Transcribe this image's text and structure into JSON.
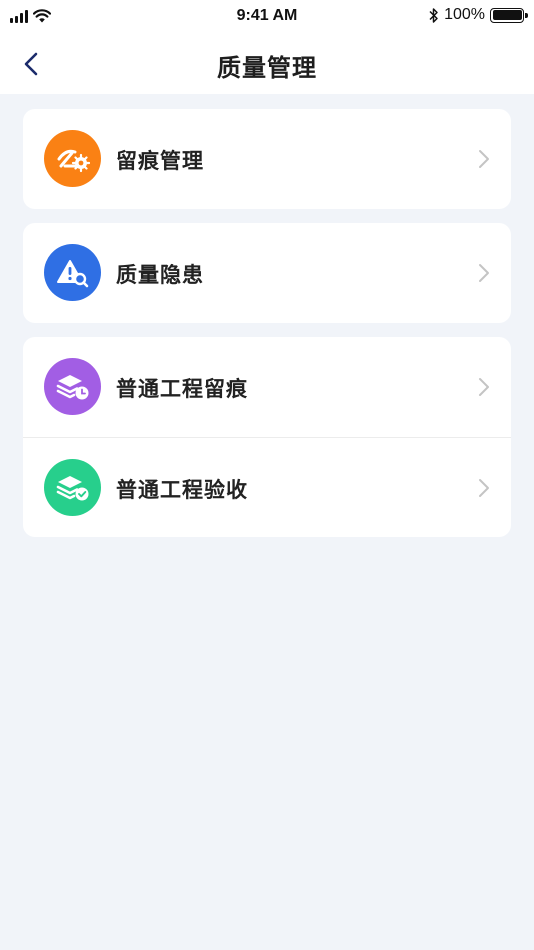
{
  "status_bar": {
    "time": "9:41 AM",
    "battery": "100%",
    "icons": [
      "signal-icon",
      "wifi-icon",
      "bluetooth-icon",
      "battery-icon"
    ]
  },
  "nav": {
    "title": "质量管理",
    "back_icon": "chevron-left-icon"
  },
  "menu": {
    "cards": [
      {
        "items": [
          {
            "label": "留痕管理",
            "icon": "trace-settings-icon",
            "color": "#fa8114"
          }
        ]
      },
      {
        "items": [
          {
            "label": "质量隐患",
            "icon": "warning-search-icon",
            "color": "#2f6fe4"
          }
        ]
      },
      {
        "items": [
          {
            "label": "普通工程留痕",
            "icon": "layers-clock-icon",
            "color": "#a25ee4"
          },
          {
            "label": "普通工程验收",
            "icon": "layers-check-icon",
            "color": "#27cf8c"
          }
        ]
      }
    ]
  },
  "colors": {
    "background": "#f1f4f9",
    "card": "#ffffff",
    "chevron": "#c4c4c4"
  }
}
